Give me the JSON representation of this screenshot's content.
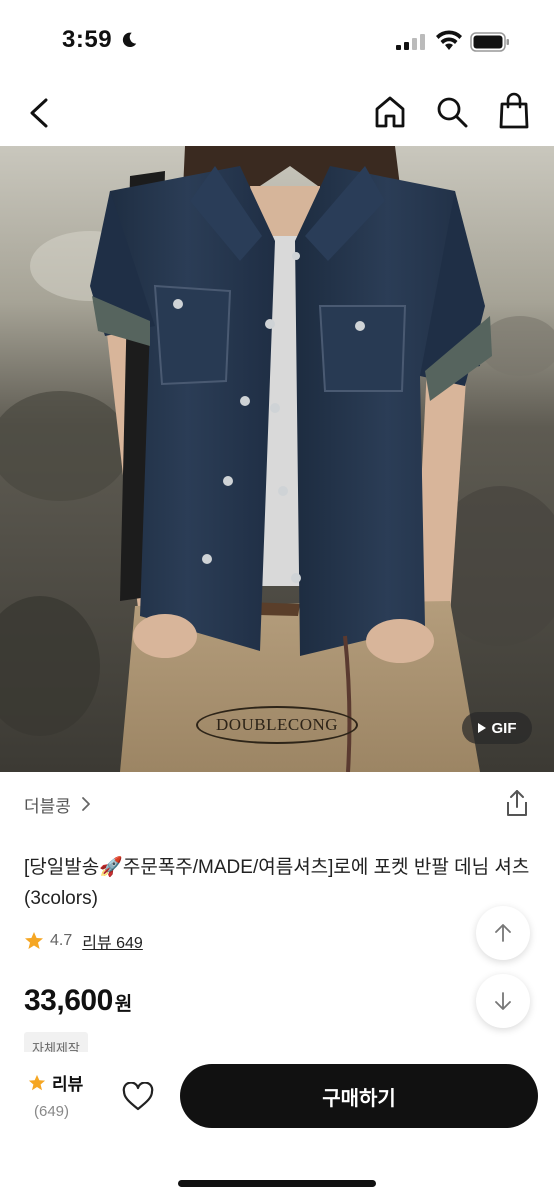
{
  "status_bar": {
    "time": "3:59"
  },
  "product": {
    "watermark": "DOUBLECONG",
    "gif_label": "GIF",
    "brand": "더블콩",
    "title": "[당일발송🚀주문폭주/MADE/여름셔츠]로에 포켓 반팔 데님 셔츠(3colors)",
    "rating": "4.7",
    "review_link": "리뷰 649",
    "price": "33,600",
    "currency": "원",
    "tag": "자체제작"
  },
  "bottom_bar": {
    "review_label": "리뷰",
    "review_count": "(649)",
    "buy_label": "구매하기"
  },
  "colors": {
    "accent_star": "#f5a623",
    "buy_button": "#111111",
    "denim": "#23344a"
  },
  "icons": [
    "moon-icon",
    "signal-icon",
    "wifi-icon",
    "battery-icon",
    "back-arrow-icon",
    "home-icon",
    "search-icon",
    "shopping-bag-icon",
    "chevron-right-icon",
    "share-icon",
    "star-icon",
    "arrow-up-icon",
    "arrow-down-icon",
    "heart-icon",
    "play-icon"
  ]
}
